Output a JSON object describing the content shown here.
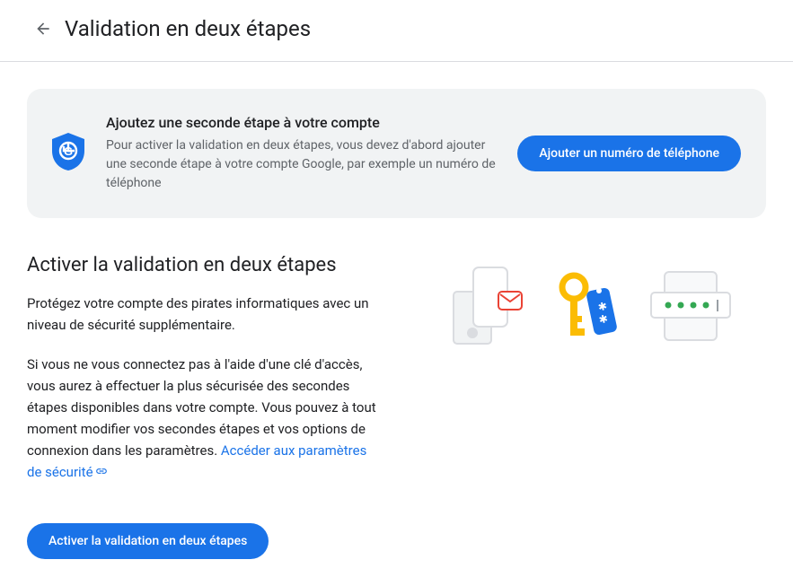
{
  "header": {
    "title": "Validation en deux étapes"
  },
  "banner": {
    "title": "Ajoutez une seconde étape à votre compte",
    "description": "Pour activer la validation en deux étapes, vous devez d'abord ajouter une seconde étape à votre compte Google, par exemple un numéro de téléphone",
    "button_label": "Ajouter un numéro de téléphone"
  },
  "main": {
    "title": "Activer la validation en deux étapes",
    "paragraph1": "Protégez votre compte des pirates informatiques avec un niveau de sécurité supplémentaire.",
    "paragraph2": "Si vous ne vous connectez pas à l'aide d'une clé d'ac­cès, vous aurez à effectuer la plus sécurisée des se­condes étapes disponibles dans votre compte. Vous pouvez à tout moment modifier vos secondes étapes et vos options de connexion dans les paramètres. ",
    "link_label": "Accéder aux paramètres de sécurité",
    "activate_button_label": "Activer la validation en deux étapes"
  }
}
